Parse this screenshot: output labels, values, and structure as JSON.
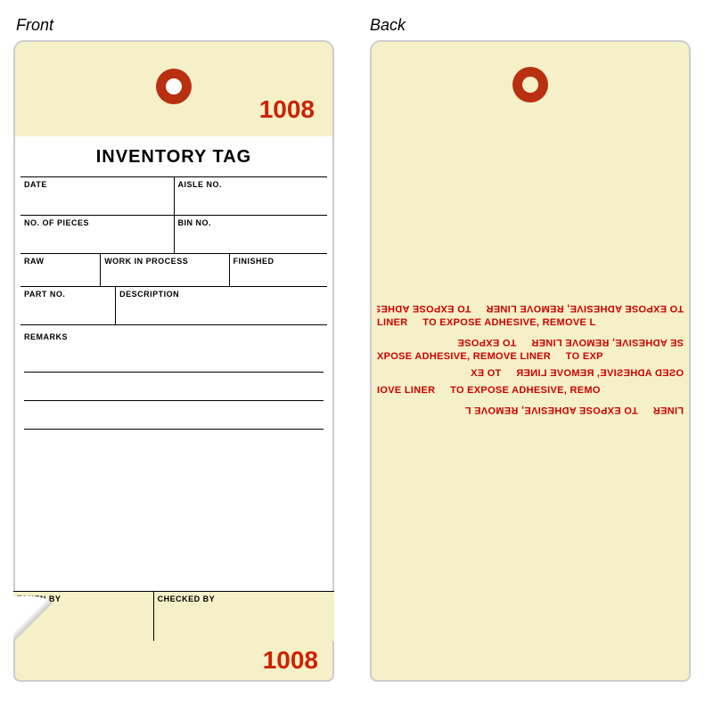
{
  "labels": {
    "front": "Front",
    "back": "Back"
  },
  "tag": {
    "number": "1008",
    "title": "INVENTORY TAG",
    "fields": {
      "date": "DATE",
      "aisle_no": "AISLE NO.",
      "no_of_pieces": "NO. OF PIECES",
      "bin_no": "BIN NO.",
      "raw": "RAW",
      "work_in_process": "WORK IN PROCESS",
      "finished": "FINISHED",
      "part_no": "PART NO.",
      "description": "DESCRIPTION",
      "remarks": "REMARKS",
      "taken_by": "TAKEN BY",
      "checked_by": "CHECKED BY"
    },
    "adhesive_text": "TO EXPOSE ADHESIVE, REMOVE LINER    TO EXPOSE ADHESIVE, REMOVE LINER    "
  }
}
